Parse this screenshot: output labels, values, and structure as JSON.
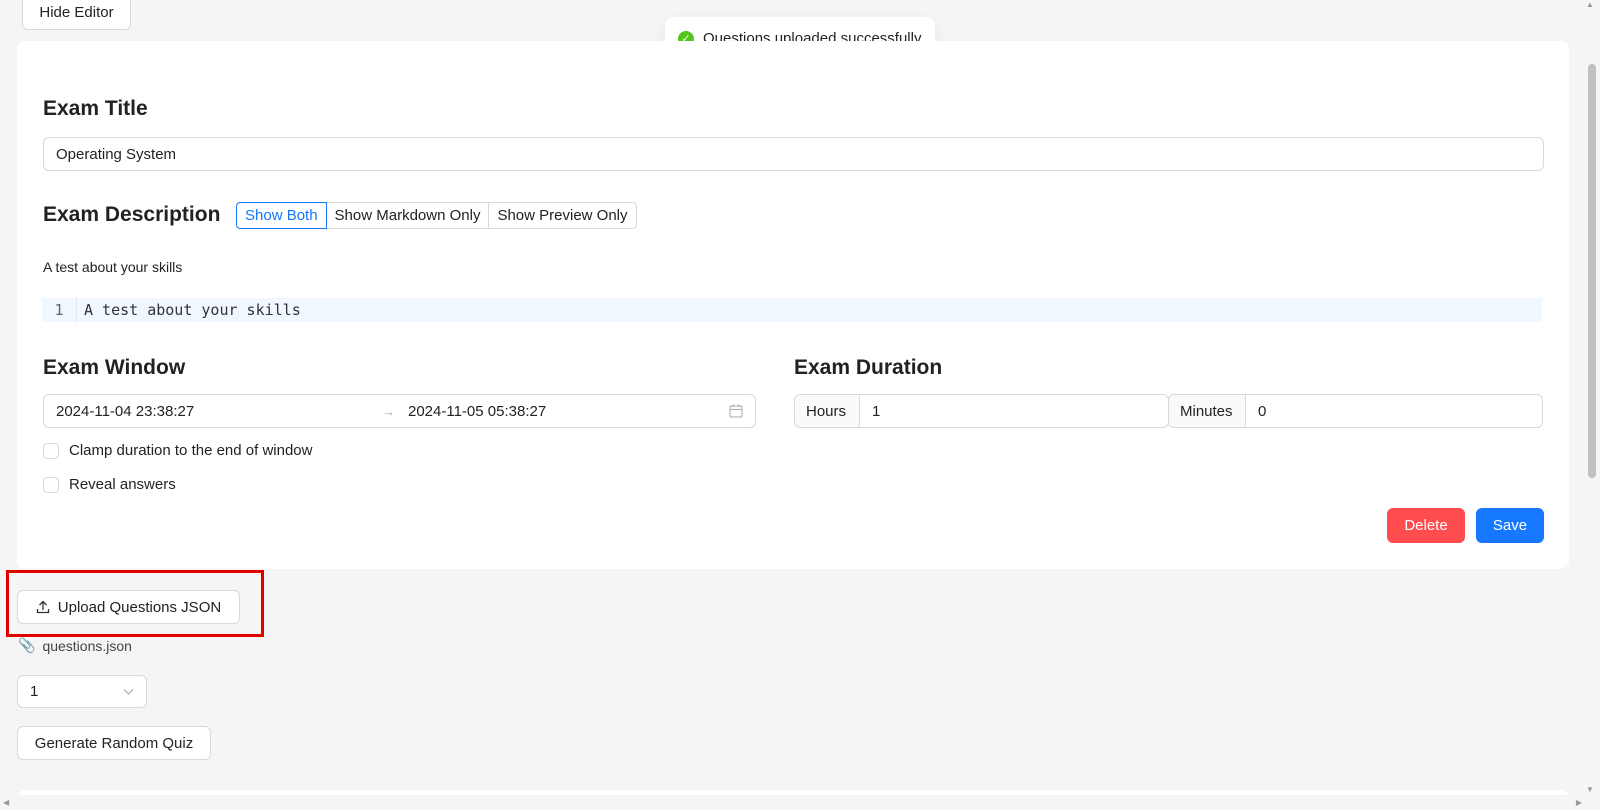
{
  "toolbar": {
    "hide_editor": "Hide Editor"
  },
  "toast": {
    "message": "Questions uploaded successfully",
    "icon": "check-circle-icon",
    "color": "#52c41a"
  },
  "exam": {
    "title_heading": "Exam Title",
    "title_value": "Operating System",
    "description_heading": "Exam Description",
    "view_modes": [
      "Show Both",
      "Show Markdown Only",
      "Show Preview Only"
    ],
    "active_view_mode": "Show Both",
    "description_preview": "A test about your skills",
    "editor": {
      "line_number": "1",
      "line_text": "A test about your skills"
    },
    "window_heading": "Exam Window",
    "window_start": "2024-11-04 23:38:27",
    "window_separator": "→",
    "window_end": "2024-11-05 05:38:27",
    "duration_heading": "Exam Duration",
    "hours_label": "Hours",
    "hours_value": "1",
    "minutes_label": "Minutes",
    "minutes_value": "0",
    "clamp_label": "Clamp duration to the end of window",
    "clamp_checked": false,
    "reveal_label": "Reveal answers",
    "reveal_checked": false,
    "delete_label": "Delete",
    "save_label": "Save"
  },
  "upload": {
    "button_label": "Upload Questions JSON",
    "file_name": "questions.json"
  },
  "quiz": {
    "count_value": "1",
    "generate_label": "Generate Random Quiz"
  },
  "colors": {
    "primary": "#1677ff",
    "danger": "#ff4d4f",
    "highlight": "#e00000"
  }
}
